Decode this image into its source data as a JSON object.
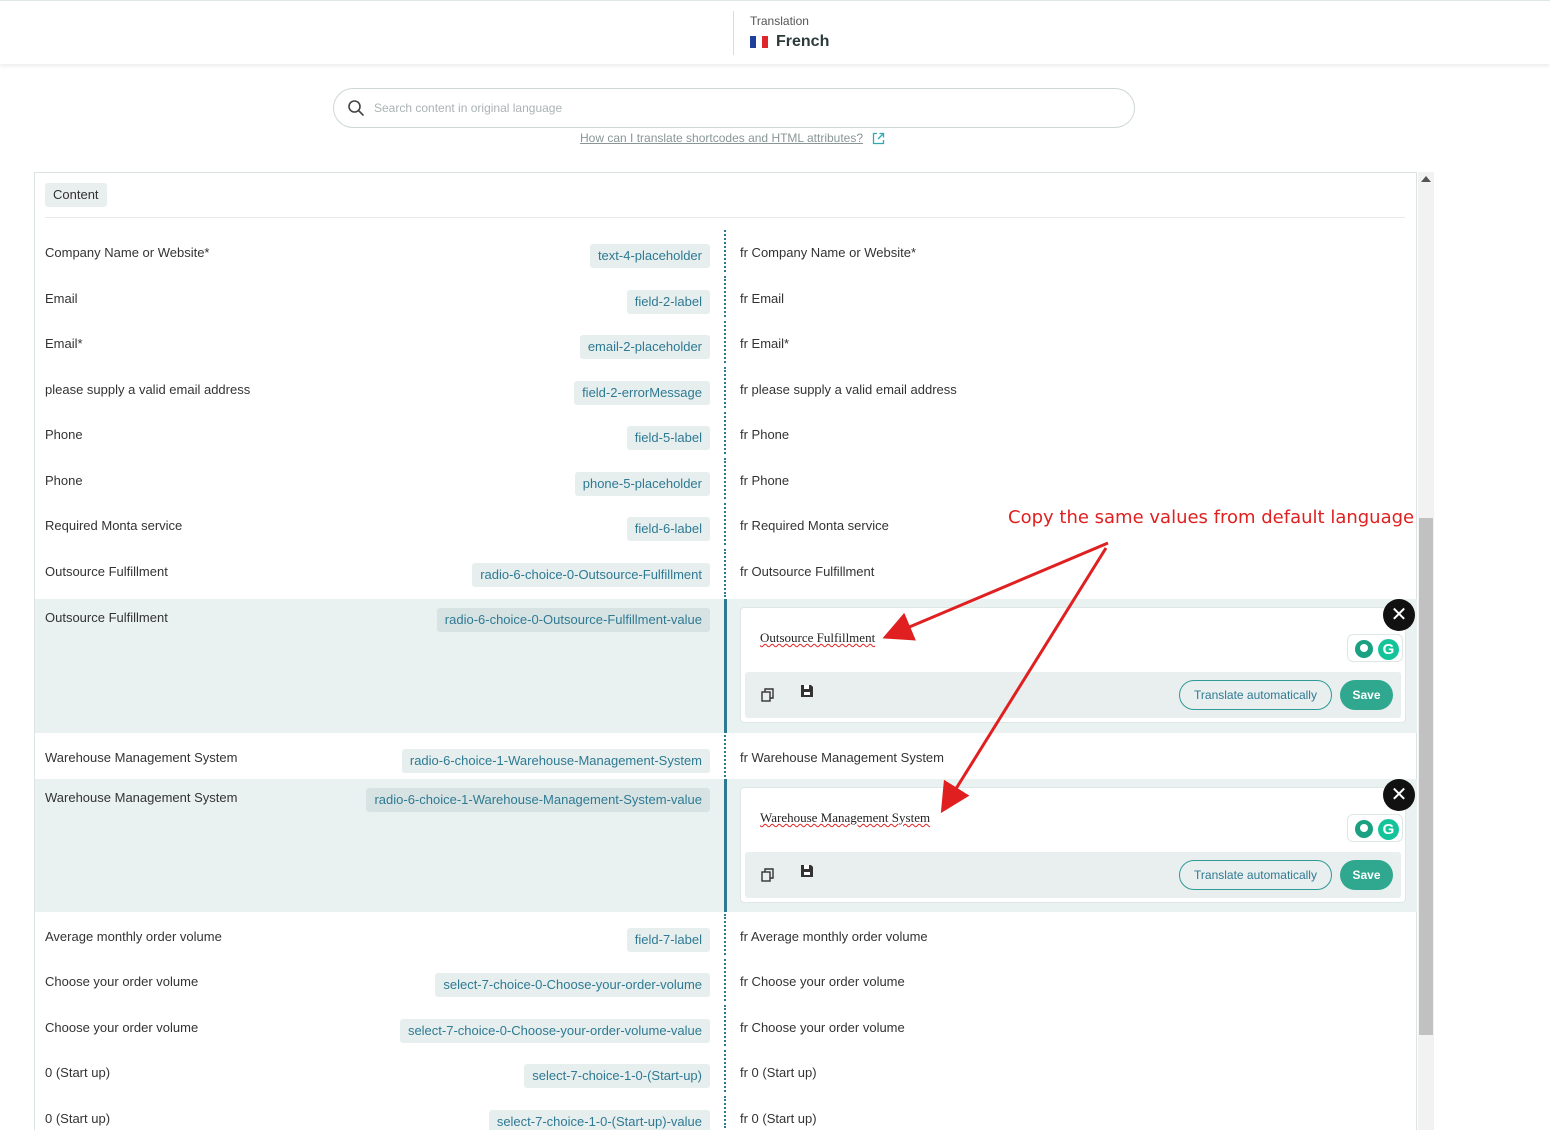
{
  "header": {
    "caption": "Translation",
    "language": "French",
    "language_flag": "france-flag-icon"
  },
  "search": {
    "placeholder": "Search content in original language"
  },
  "help_link": "How can I translate shortcodes and HTML attributes?",
  "section_tag": "Content",
  "annotation": "Copy the same values from default language",
  "colors": {
    "accent": "#2f7a93",
    "save": "#2fa88f",
    "annotation": "#e02020"
  },
  "rows": [
    {
      "source": "Company Name or Website*",
      "key": "text-4-placeholder",
      "target": "fr Company Name or Website*"
    },
    {
      "source": "Email",
      "key": "field-2-label",
      "target": "fr Email"
    },
    {
      "source": "Email*",
      "key": "email-2-placeholder",
      "target": "fr Email*"
    },
    {
      "source": "please supply a valid email address",
      "key": "field-2-errorMessage",
      "target": "fr please supply a valid email address"
    },
    {
      "source": "Phone",
      "key": "field-5-label",
      "target": "fr Phone"
    },
    {
      "source": "Phone",
      "key": "phone-5-placeholder",
      "target": "fr Phone"
    },
    {
      "source": "Required Monta service",
      "key": "field-6-label",
      "target": "fr Required Monta service"
    },
    {
      "source": "Outsource Fulfillment",
      "key": "radio-6-choice-0-Outsource-Fulfillment",
      "target": "fr Outsource Fulfillment"
    },
    {
      "source": "Outsource Fulfillment",
      "key": "radio-6-choice-0-Outsource-Fulfillment-value",
      "editor_value": "Outsource Fulfillment",
      "translate_label": "Translate automatically",
      "save_label": "Save"
    },
    {
      "source": "Warehouse Management System",
      "key": "radio-6-choice-1-Warehouse-Management-System",
      "target": "fr Warehouse Management System"
    },
    {
      "source": "Warehouse Management System",
      "key": "radio-6-choice-1-Warehouse-Management-System-value",
      "editor_value": "Warehouse Management System",
      "translate_label": "Translate automatically",
      "save_label": "Save"
    },
    {
      "source": "Average monthly order volume",
      "key": "field-7-label",
      "target": "fr Average monthly order volume"
    },
    {
      "source": "Choose your order volume",
      "key": "select-7-choice-0-Choose-your-order-volume",
      "target": "fr Choose your order volume"
    },
    {
      "source": "Choose your order volume",
      "key": "select-7-choice-0-Choose-your-order-volume-value",
      "target": "fr Choose your order volume"
    },
    {
      "source": "0 (Start up)",
      "key": "select-7-choice-1-0-(Start-up)",
      "target": "fr 0 (Start up)"
    },
    {
      "source": "0 (Start up)",
      "key": "select-7-choice-1-0-(Start-up)-value",
      "target": "fr 0 (Start up)"
    }
  ]
}
